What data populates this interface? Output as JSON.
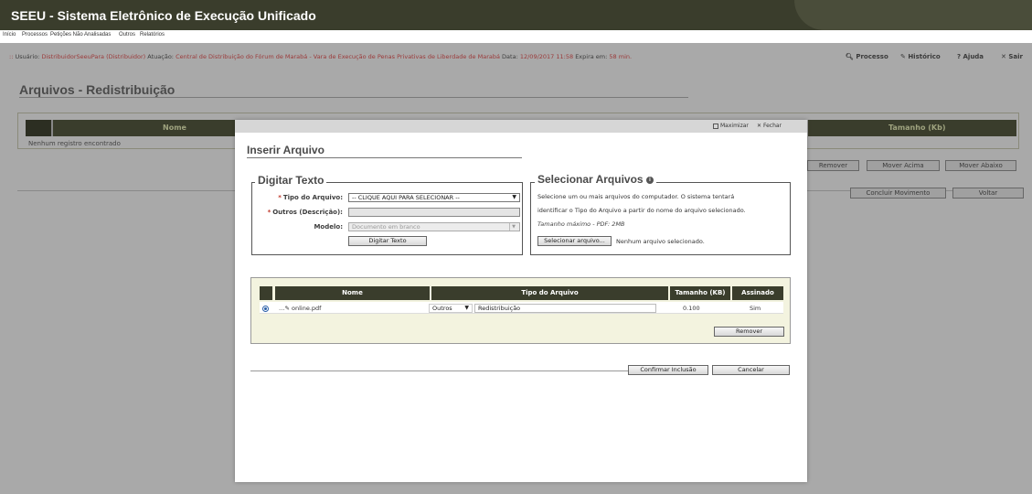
{
  "app": {
    "title": "SEEU - Sistema Eletrônico de Execução Unificado"
  },
  "menu": [
    "Início",
    "Processos",
    "Petições Não Analisadas",
    "Outros",
    "Relatórios"
  ],
  "info": {
    "bullet": "::",
    "user_label": "Usuário:",
    "user_value": "DistribuidorSeeuPara (Distribuidor)",
    "atuacao_label": "Atuação:",
    "atuacao_value": "Central de Distribuição do Fórum de Marabá - Vara de Execução de Penas Privativas de Liberdade de Marabá",
    "date_label": "Data:",
    "date_value": "12/09/2017 11:58",
    "expira_label": "Expira em:",
    "expira_value": "58 min."
  },
  "top_links": {
    "processo": "Processo",
    "historico": "Histórico",
    "ajuda": "Ajuda",
    "sair": "Sair"
  },
  "background": {
    "title": "Arquivos - Redistribuição",
    "col_nome": "Nome",
    "col_tamanho": "Tamanho (Kb)",
    "empty": "Nenhum registro encontrado",
    "buttons": {
      "remover": "Remover",
      "mover_acima": "Mover Acima",
      "mover_abaixo": "Mover Abaixo",
      "concluir": "Concluir Movimento",
      "voltar": "Voltar"
    }
  },
  "modal": {
    "maximize": "Maximizar",
    "close": "Fechar",
    "title": "Inserir Arquivo",
    "digitar": {
      "legend": "Digitar Texto",
      "tipo_label": "Tipo do Arquivo:",
      "tipo_value": "-- CLIQUE AQUI PARA SELECIONAR --",
      "outros_label": "Outros (Descrição):",
      "modelo_label": "Modelo:",
      "modelo_value": "Documento em branco",
      "button": "Digitar Texto"
    },
    "selecionar": {
      "legend": "Selecionar Arquivos",
      "desc1": "Selecione um ou mais arquivos do computador. O sistema tentará",
      "desc2": "identificar o Tipo do Arquivo a partir do nome do arquivo selecionado.",
      "max": "Tamanho máximo - PDF: 2MB",
      "button": "Selecionar arquivo...",
      "status": "Nenhum arquivo selecionado."
    },
    "table": {
      "headers": {
        "nome": "Nome",
        "tipo": "Tipo do Arquivo",
        "tamanho": "Tamanho (KB)",
        "assinado": "Assinado"
      },
      "rows": [
        {
          "nome": "online.pdf",
          "tipo": "Outros",
          "descricao": "Redistribuição",
          "tamanho": "0.100",
          "assinado": "Sim"
        }
      ],
      "remover": "Remover"
    },
    "confirmar": "Confirmar Inclusão",
    "cancelar": "Cancelar"
  }
}
